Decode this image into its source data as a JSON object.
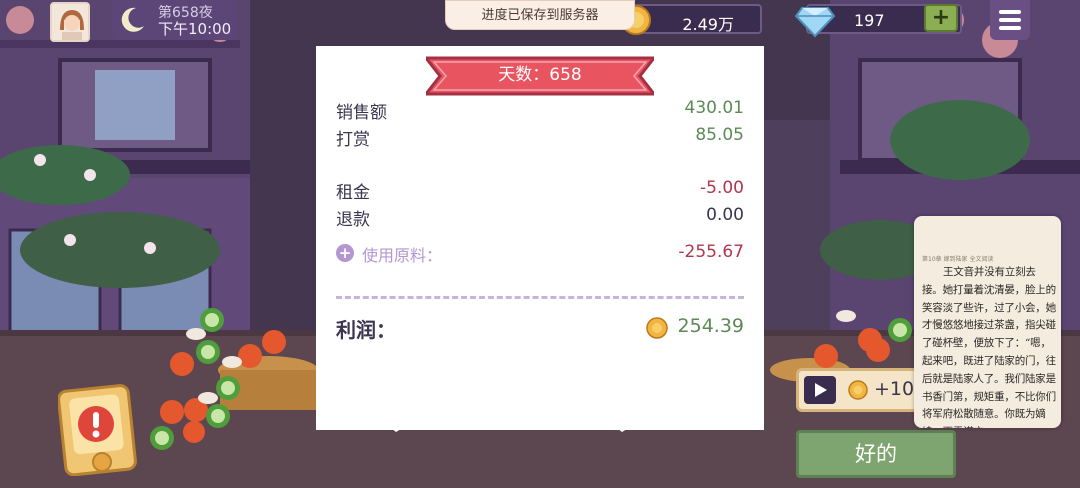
{
  "hud": {
    "day_label": "第658夜",
    "time_label": "下午10:00",
    "toast": "进度已保存到服务器",
    "coins": "2.49万",
    "gems": "197",
    "plus": "+"
  },
  "receipt": {
    "ribbon": "天数：658",
    "sales_label": "销售额",
    "sales_value": "430.01",
    "tips_label": "打赏",
    "tips_value": "85.05",
    "rent_label": "租金",
    "rent_value": "-5.00",
    "refund_label": "退款",
    "refund_value": "0.00",
    "ingredients_label": "使用原料：",
    "ingredients_value": "-255.67",
    "profit_label": "利润：",
    "profit_value": "254.39"
  },
  "reward": {
    "label": "+10"
  },
  "ok_button": "好的",
  "reader": {
    "header": "第10章 嫁到陆家 全文阅读",
    "body": "王文音并没有立刻去接。她打量着沈清晏，脸上的笑容淡了些许，过了小会，她才慢悠悠地接过茶盏，指尖碰了碰杯壁，便放下了：“嗯，起来吧，既进了陆家的门，往后就是陆家人了。我们陆家是书香门第，规矩重，不比你们将军府松散随意。你既为嫡媳，更需谨言"
  },
  "colors": {
    "positive": "#5b8a56",
    "negative": "#b0364f",
    "ribbon": "#e85560",
    "ok_button": "#7ea56f"
  }
}
